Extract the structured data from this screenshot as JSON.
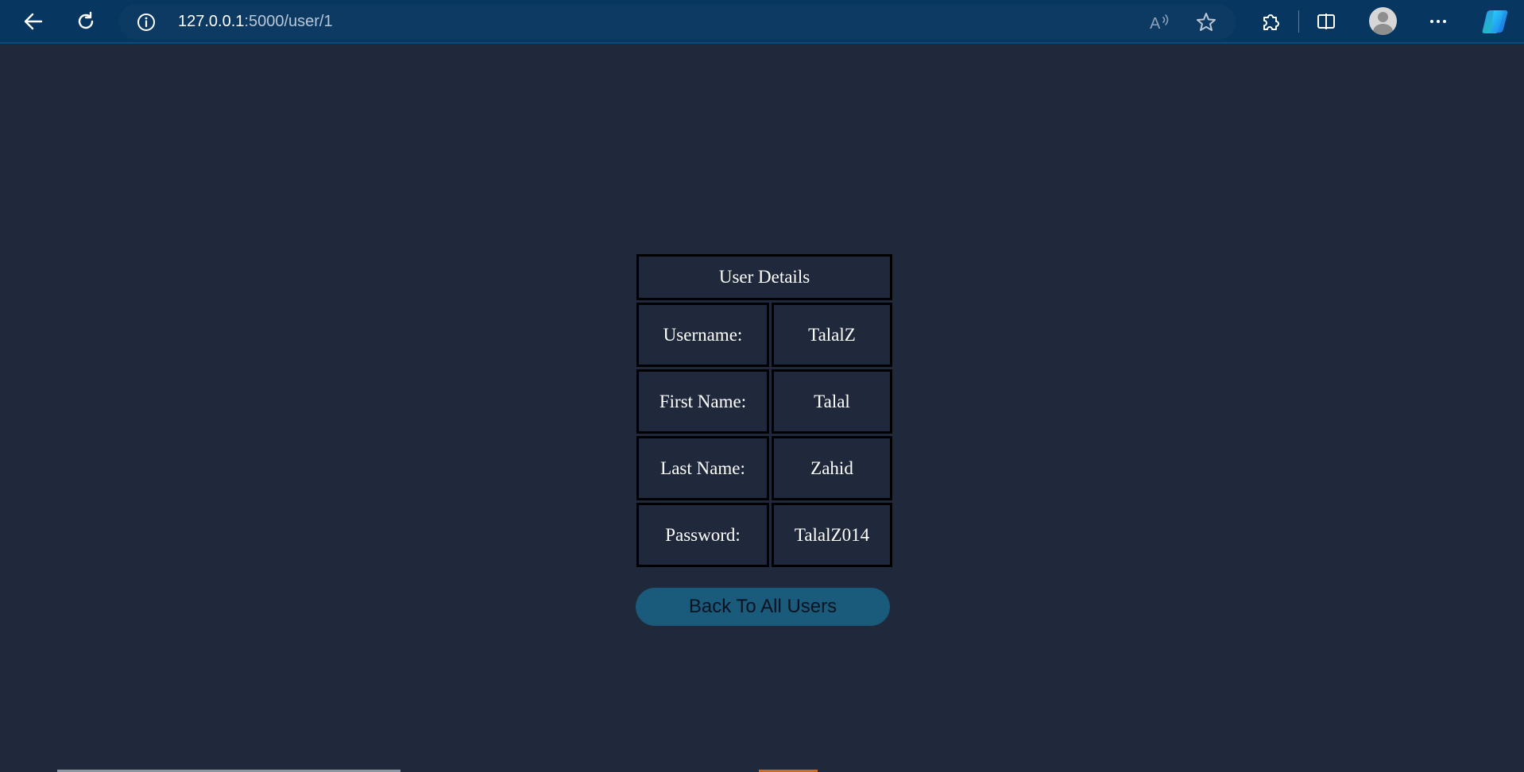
{
  "browser": {
    "url_host": "127.0.0.1",
    "url_path": ":5000/user/1"
  },
  "page": {
    "table_header": "User Details",
    "rows": [
      {
        "label": "Username:",
        "value": "TalalZ"
      },
      {
        "label": "First Name:",
        "value": "Talal"
      },
      {
        "label": "Last Name:",
        "value": "Zahid"
      },
      {
        "label": "Password:",
        "value": "TalalZ014"
      }
    ],
    "back_button_label": "Back To All Users"
  },
  "icons": {
    "back": "back-arrow-icon",
    "refresh": "refresh-icon",
    "site_info": "info-icon",
    "read_aloud": "read-aloud-icon",
    "favorite": "star-icon",
    "extensions": "puzzle-icon",
    "split_screen": "split-screen-icon",
    "profile": "avatar-icon",
    "menu": "more-icon",
    "copilot": "copilot-icon"
  },
  "colors": {
    "page_background": "#1f293b",
    "browser_chrome": "#073760",
    "button_background": "#1a5a7a",
    "cell_border": "#000000"
  }
}
